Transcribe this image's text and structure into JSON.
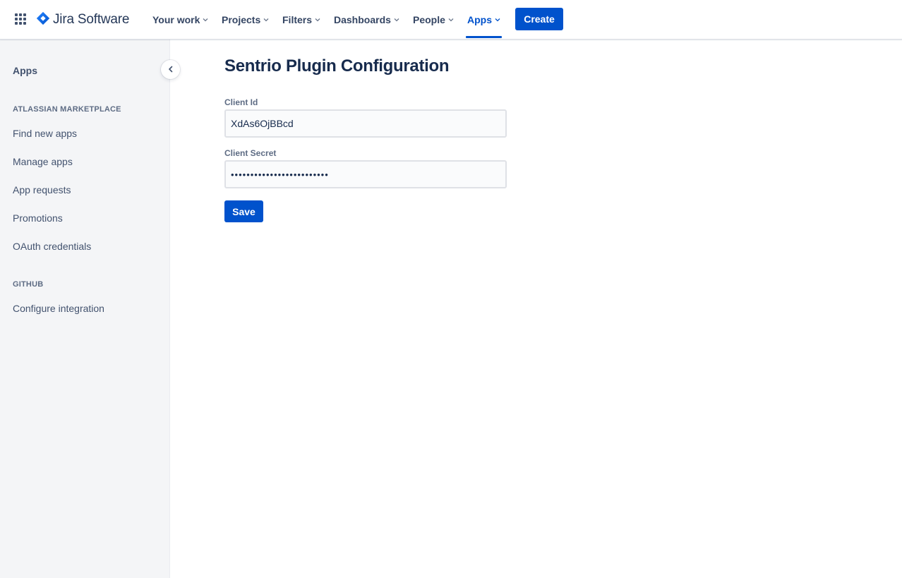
{
  "header": {
    "app_switcher_icon": "app-grid-icon",
    "logo_icon": "jira-diamond-icon",
    "logo_text": "Jira Software",
    "nav": [
      {
        "label": "Your work"
      },
      {
        "label": "Projects"
      },
      {
        "label": "Filters"
      },
      {
        "label": "Dashboards"
      },
      {
        "label": "People"
      },
      {
        "label": "Apps",
        "active": true
      }
    ],
    "create_label": "Create"
  },
  "sidebar": {
    "title": "Apps",
    "collapse_icon": "chevron-left-icon",
    "sections": [
      {
        "heading": "ATLASSIAN MARKETPLACE",
        "items": [
          "Find new apps",
          "Manage apps",
          "App requests",
          "Promotions",
          "OAuth credentials"
        ]
      },
      {
        "heading": "GITHUB",
        "items": [
          "Configure integration"
        ]
      }
    ]
  },
  "main": {
    "title": "Sentrio Plugin Configuration",
    "client_id": {
      "label": "Client Id",
      "value": "XdAs6OjBBcd"
    },
    "client_secret": {
      "label": "Client Secret",
      "value": "xxxxxxxxxxxxxxxxxxxxxxxxx"
    },
    "save_label": "Save"
  },
  "colors": {
    "primary": "#0052cc",
    "text": "#172b4d",
    "sidebar_bg": "#f4f5f7",
    "logo_blue": "#2684ff"
  }
}
